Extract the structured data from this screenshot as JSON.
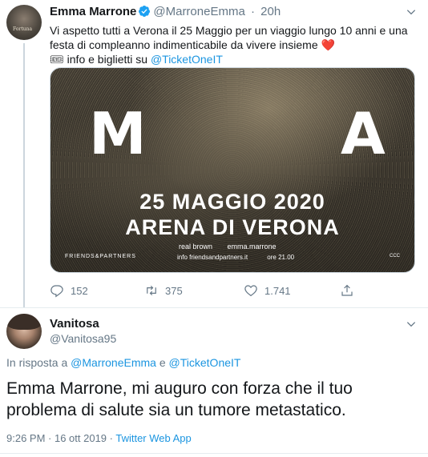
{
  "tweet": {
    "author_name": "Emma Marrone",
    "author_handle": "@MarroneEmma",
    "time_sep": "·",
    "time": "20h",
    "avatar_text": "Fortuna",
    "text_line1": "Vi aspetto tutti a Verona il 25 Maggio per un viaggio lungo 10 anni e una",
    "text_line2": "festa di compleanno indimenticabile da vivere insieme ❤️",
    "text_line3_prefix": "🎟 info e biglietti su ",
    "text_line3_mention": "@TicketOneIT",
    "media": {
      "letter_left": "M",
      "letter_right": "A",
      "date": "25 MAGGIO 2020",
      "venue": "ARENA DI VERONA",
      "social_1": "real brown",
      "social_2": "emma.marrone",
      "info": "info friendsandpartners.it",
      "hour": "ore 21.00",
      "promoter": "FRIENDS&PARTNERS",
      "credit": "CCC"
    },
    "actions": {
      "replies": "152",
      "retweets": "375",
      "likes": "1.741"
    }
  },
  "reply": {
    "author_name": "Vanitosa",
    "author_handle": "@Vanitosa95",
    "reply_prefix": "In risposta a ",
    "reply_mention1": "@MarroneEmma",
    "reply_join": " e ",
    "reply_mention2": "@TicketOneIT",
    "text_line1": "Emma Marrone, mi auguro con forza che il tuo",
    "text_line2": "problema di salute sia un tumore metastatico.",
    "timestamp": "9:26 PM · 16 ott 2019 · ",
    "app": "Twitter Web App"
  },
  "colors": {
    "accent": "#1b95e0",
    "muted": "#657786",
    "heart": "#e0245e",
    "verified": "#1da1f2"
  },
  "icons": [
    "verified-icon",
    "chevron-down-icon",
    "reply-icon",
    "retweet-icon",
    "like-icon",
    "share-icon"
  ]
}
